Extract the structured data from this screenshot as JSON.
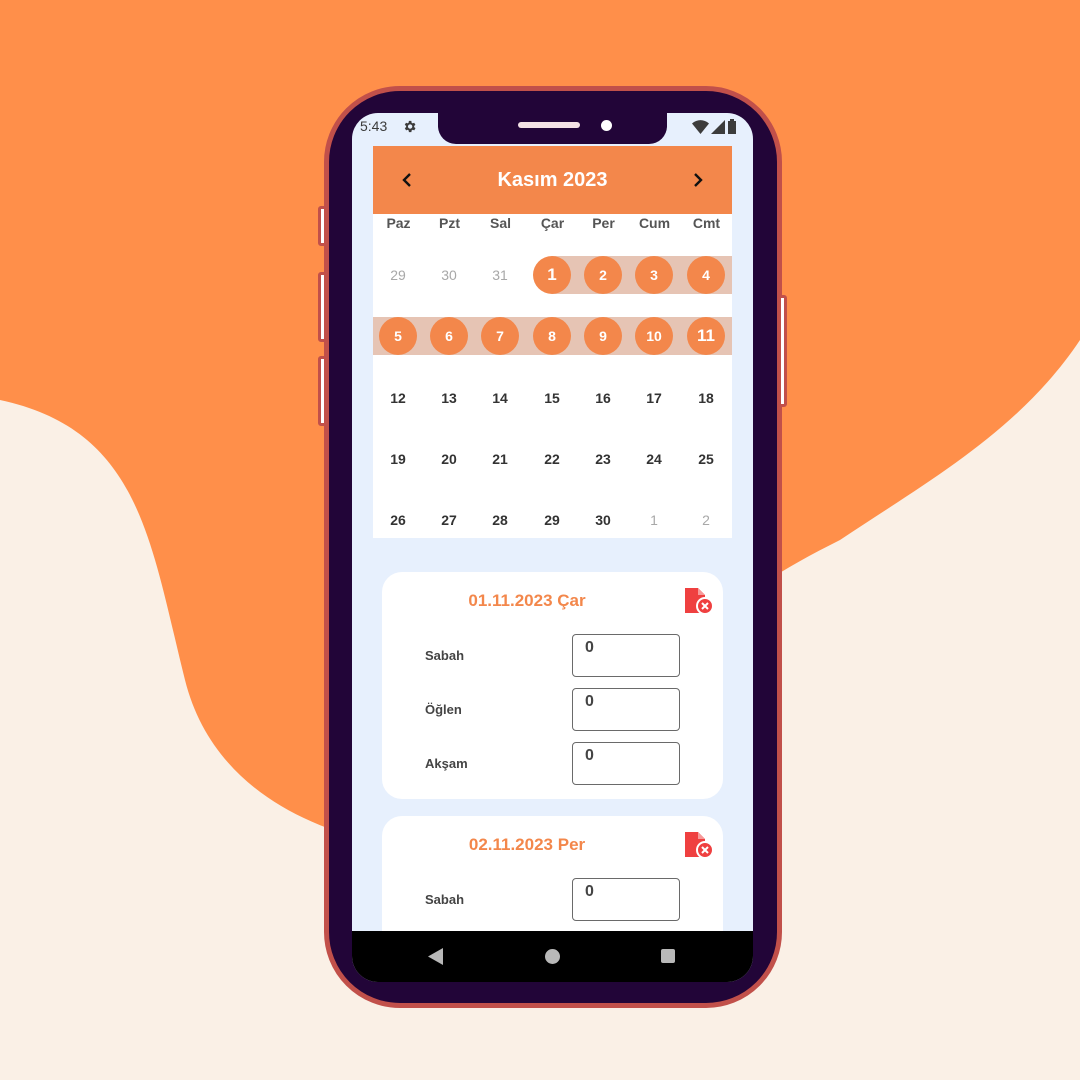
{
  "colors": {
    "accent": "#f3874b",
    "background_orange": "#ff8f4a",
    "background_cream": "#faf0e6",
    "phone_body": "#220538",
    "delete_red": "#ef4040"
  },
  "status_bar": {
    "time": "5:43",
    "icons": [
      "gear-icon",
      "wifi-icon",
      "signal-icon",
      "battery-icon"
    ]
  },
  "calendar": {
    "title": "Kasım 2023",
    "prev_icon": "chevron-left-icon",
    "next_icon": "chevron-right-icon",
    "weekdays": [
      "Paz",
      "Pzt",
      "Sal",
      "Çar",
      "Per",
      "Cum",
      "Cmt"
    ],
    "weeks": [
      [
        "29",
        "30",
        "31",
        "1",
        "2",
        "3",
        "4"
      ],
      [
        "5",
        "6",
        "7",
        "8",
        "9",
        "10",
        "11"
      ],
      [
        "12",
        "13",
        "14",
        "15",
        "16",
        "17",
        "18"
      ],
      [
        "19",
        "20",
        "21",
        "22",
        "23",
        "24",
        "25"
      ],
      [
        "26",
        "27",
        "28",
        "29",
        "30",
        "1",
        "2"
      ]
    ],
    "selected_range": "1–11"
  },
  "entries": [
    {
      "date": "01.11.2023 Çar",
      "rows": [
        {
          "label": "Sabah",
          "value": "0"
        },
        {
          "label": "Öğlen",
          "value": "0"
        },
        {
          "label": "Akşam",
          "value": "0"
        }
      ]
    },
    {
      "date": "02.11.2023 Per",
      "rows": [
        {
          "label": "Sabah",
          "value": "0"
        }
      ]
    }
  ],
  "nav_bar": {
    "icons": [
      "back-icon",
      "home-icon",
      "recents-icon"
    ]
  }
}
